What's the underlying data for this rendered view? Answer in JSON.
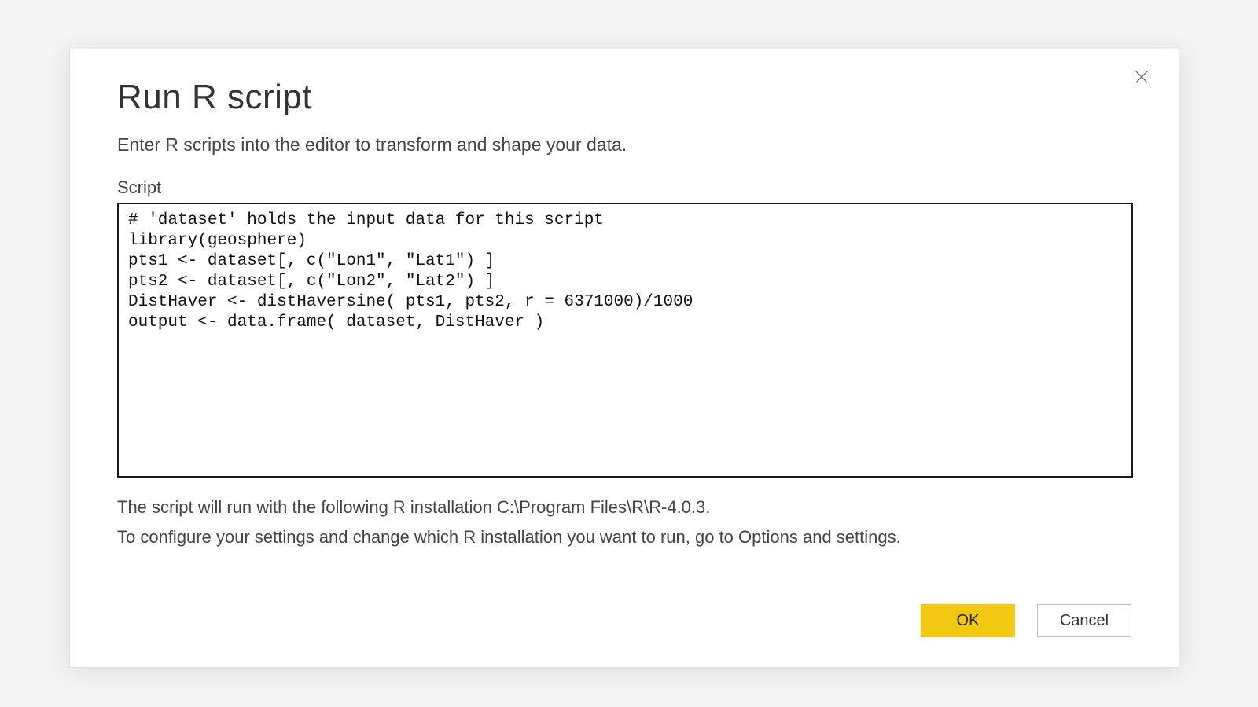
{
  "dialog": {
    "title": "Run R script",
    "subtitle": "Enter R scripts into the editor to transform and shape your data.",
    "script_label": "Script",
    "script_value": "# 'dataset' holds the input data for this script\nlibrary(geosphere)\npts1 <- dataset[, c(\"Lon1\", \"Lat1\") ]\npts2 <- dataset[, c(\"Lon2\", \"Lat2\") ]\nDistHaver <- distHaversine( pts1, pts2, r = 6371000)/1000\noutput <- data.frame( dataset, DistHaver )",
    "info_line1": "The script will run with the following R installation C:\\Program Files\\R\\R-4.0.3.",
    "info_line2": "To configure your settings and change which R installation you want to run, go to Options and settings.",
    "ok_label": "OK",
    "cancel_label": "Cancel"
  },
  "icons": {
    "close": "close-icon"
  },
  "colors": {
    "accent": "#f2c811",
    "dialog_bg": "#ffffff",
    "backdrop": "#f4f4f4",
    "border_dark": "#1a1a1a"
  }
}
